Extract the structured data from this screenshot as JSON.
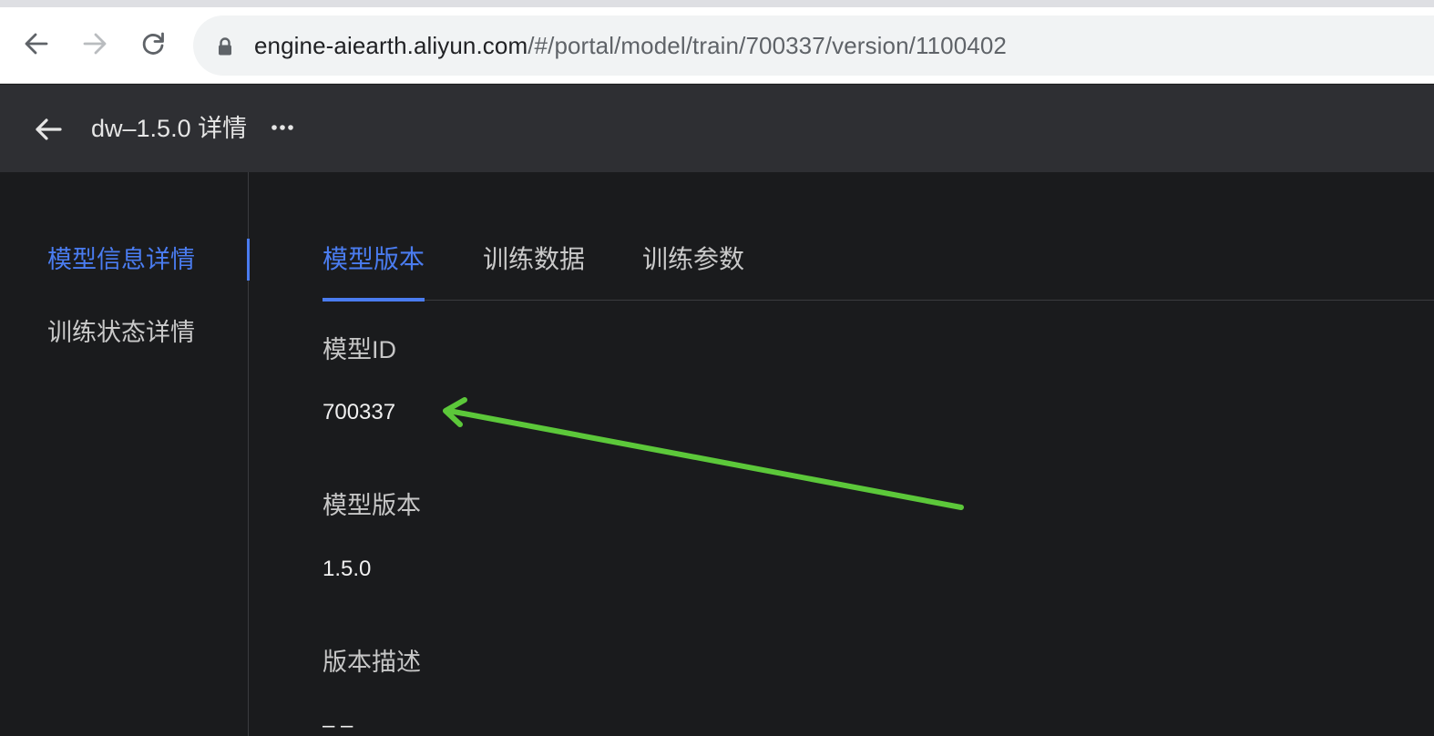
{
  "browser": {
    "url_host": "engine-aiearth.aliyun.com",
    "url_path": "/#/portal/model/train/700337/version/1100402",
    "icons": [
      "back-arrow-icon",
      "forward-arrow-icon",
      "reload-icon",
      "lock-icon"
    ]
  },
  "header": {
    "title": "dw–1.5.0 详情",
    "icons": [
      "back-arrow-icon",
      "more-horizontal-icon"
    ]
  },
  "sidebar": {
    "items": [
      {
        "label": "模型信息详情",
        "active": true
      },
      {
        "label": "训练状态详情",
        "active": false
      }
    ]
  },
  "tabs": [
    {
      "label": "模型版本",
      "active": true
    },
    {
      "label": "训练数据",
      "active": false
    },
    {
      "label": "训练参数",
      "active": false
    }
  ],
  "fields": [
    {
      "label": "模型ID",
      "value": "700337"
    },
    {
      "label": "模型版本",
      "value": "1.5.0"
    },
    {
      "label": "版本描述",
      "value": "– –"
    }
  ],
  "colors": {
    "accent": "#4a7cf0",
    "annotation_arrow": "#5cc83a",
    "header_bg": "#2e2f33",
    "content_bg": "#1a1b1d"
  }
}
